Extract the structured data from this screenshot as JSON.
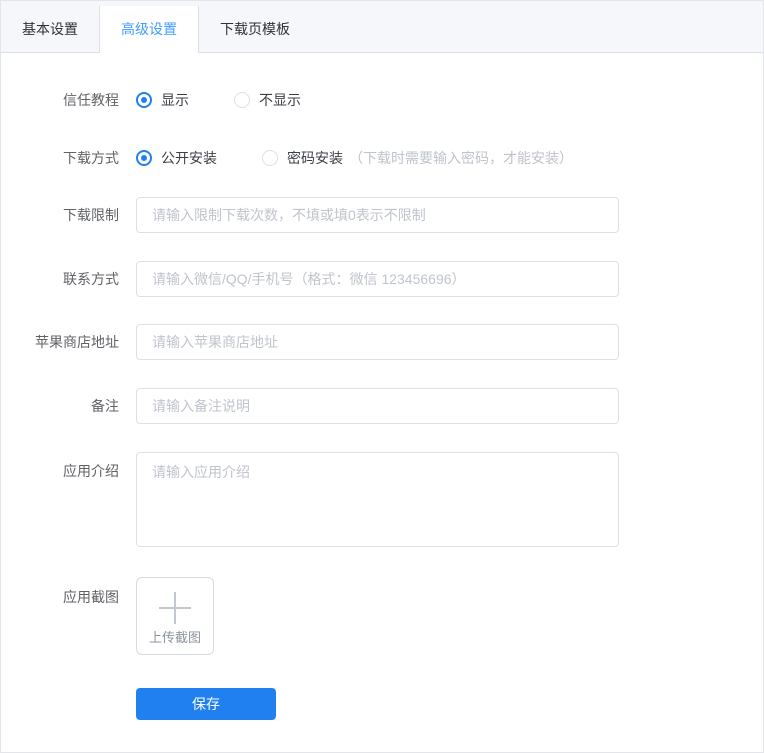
{
  "tabs": [
    {
      "label": "基本设置",
      "active": false
    },
    {
      "label": "高级设置",
      "active": true
    },
    {
      "label": "下载页模板",
      "active": false
    }
  ],
  "form": {
    "trust_tutorial": {
      "label": "信任教程",
      "options": [
        {
          "label": "显示",
          "selected": true
        },
        {
          "label": "不显示",
          "selected": false
        }
      ]
    },
    "download_method": {
      "label": "下载方式",
      "options": [
        {
          "label": "公开安装",
          "selected": true
        },
        {
          "label": "密码安装",
          "selected": false,
          "hint": "（下载时需要输入密码，才能安装）"
        }
      ]
    },
    "download_limit": {
      "label": "下载限制",
      "value": "",
      "placeholder": "请输入限制下载次数，不填或填0表示不限制"
    },
    "contact": {
      "label": "联系方式",
      "value": "",
      "placeholder": "请输入微信/QQ/手机号（格式：微信 123456696）"
    },
    "apple_store": {
      "label": "苹果商店地址",
      "value": "",
      "placeholder": "请输入苹果商店地址"
    },
    "remark": {
      "label": "备注",
      "value": "",
      "placeholder": "请输入备注说明"
    },
    "app_intro": {
      "label": "应用介绍",
      "value": "",
      "placeholder": "请输入应用介绍"
    },
    "app_screenshot": {
      "label": "应用截图",
      "upload_icon": "plus-icon",
      "upload_text": "上传截图"
    },
    "save_label": "保存"
  },
  "colors": {
    "primary": "#2080f0",
    "tab_active_text": "#409eff",
    "tab_bar_bg": "#f5f7fa",
    "border": "#dcdfe6",
    "placeholder": "#c0c4cc"
  }
}
